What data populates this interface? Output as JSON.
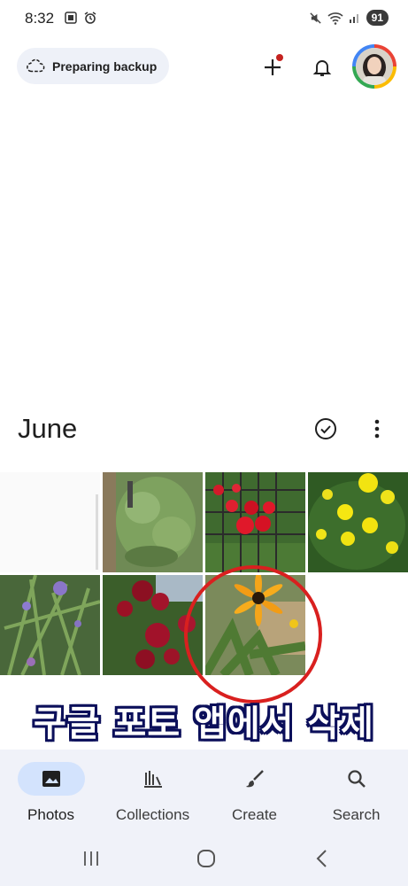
{
  "status_bar": {
    "time": "8:32",
    "battery": "91"
  },
  "header": {
    "backup_chip_label": "Preparing backup"
  },
  "section": {
    "month": "June"
  },
  "photos": [
    {
      "name": "blank"
    },
    {
      "name": "green-shrub"
    },
    {
      "name": "red-flowers-trellis"
    },
    {
      "name": "yellow-flowers"
    },
    {
      "name": "purple-spiderwort"
    },
    {
      "name": "red-roses"
    },
    {
      "name": "black-eyed-susan"
    }
  ],
  "overlay": {
    "caption": "구글 포토 앱에서 삭제"
  },
  "bottom_nav": {
    "items": [
      {
        "label": "Photos"
      },
      {
        "label": "Collections"
      },
      {
        "label": "Create"
      },
      {
        "label": "Search"
      }
    ]
  },
  "colors": {
    "accent": "#d9201f",
    "nav_bg": "#f0f2f9",
    "active_pill": "#d3e3fd"
  }
}
